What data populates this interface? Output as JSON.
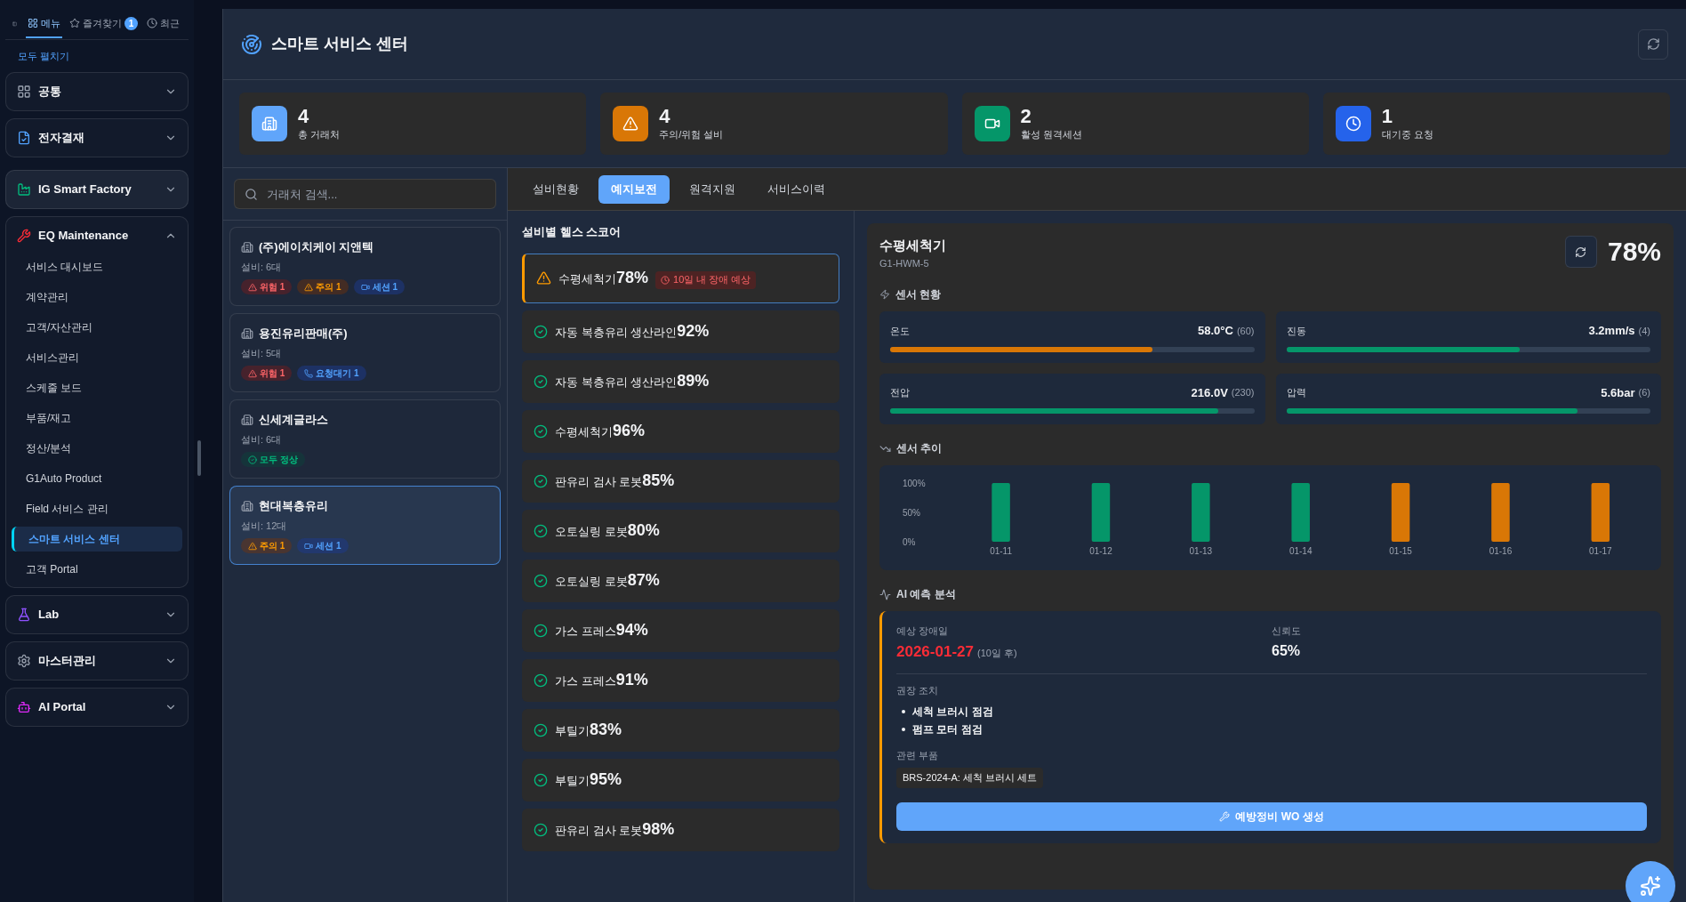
{
  "sidebar": {
    "tabs": [
      {
        "label": "메뉴",
        "selected": true
      },
      {
        "label": "즐겨찾기",
        "badge": "1",
        "selected": false
      },
      {
        "label": "최근",
        "selected": false
      }
    ],
    "expand_all": "모두 펼치기",
    "groups": [
      {
        "label": "공통",
        "expanded": false
      },
      {
        "label": "전자결재",
        "expanded": false
      },
      {
        "label": "IG Smart Factory",
        "expanded": false
      },
      {
        "label": "EQ Maintenance",
        "expanded": true,
        "items": [
          {
            "label": "서비스 대시보드",
            "selected": false
          },
          {
            "label": "계약관리",
            "selected": false
          },
          {
            "label": "고객/자산관리",
            "selected": false
          },
          {
            "label": "서비스관리",
            "selected": false
          },
          {
            "label": "스케줄 보드",
            "selected": false
          },
          {
            "label": "부품/재고",
            "selected": false
          },
          {
            "label": "정산/분석",
            "selected": false
          },
          {
            "label": "G1Auto Product",
            "selected": false
          },
          {
            "label": "Field 서비스 관리",
            "selected": false
          },
          {
            "label": "스마트 서비스 센터",
            "selected": true
          },
          {
            "label": "고객 Portal",
            "selected": false
          }
        ]
      },
      {
        "label": "Lab",
        "expanded": false
      },
      {
        "label": "마스터관리",
        "expanded": false
      },
      {
        "label": "AI Portal",
        "expanded": false
      }
    ]
  },
  "header": {
    "title": "스마트 서비스 센터"
  },
  "stats": [
    {
      "value": "4",
      "label": "총 거래처",
      "color": "#60a5fa"
    },
    {
      "value": "4",
      "label": "주의/위험 설비",
      "color": "#d97706"
    },
    {
      "value": "2",
      "label": "활성 원격세션",
      "color": "#059669"
    },
    {
      "value": "1",
      "label": "대기중 요청",
      "color": "#2563eb"
    }
  ],
  "customers": {
    "search": {
      "placeholder": "거래처 검색..."
    },
    "items": [
      {
        "name": "(주)에이치케이 지앤텍",
        "equipment": "설비: 6대",
        "selected": false,
        "tags": [
          {
            "kind": "danger",
            "label": "위험 1"
          },
          {
            "kind": "warning",
            "label": "주의 1"
          },
          {
            "kind": "session",
            "label": "세션 1"
          }
        ]
      },
      {
        "name": "용진유리판매(주)",
        "equipment": "설비: 5대",
        "selected": false,
        "tags": [
          {
            "kind": "danger",
            "label": "위험 1"
          },
          {
            "kind": "request",
            "label": "요청대기 1"
          }
        ]
      },
      {
        "name": "신세계글라스",
        "equipment": "설비: 6대",
        "selected": false,
        "tags": [
          {
            "kind": "ok",
            "label": "모두 정상"
          }
        ]
      },
      {
        "name": "현대복층유리",
        "equipment": "설비: 12대",
        "selected": true,
        "tags": [
          {
            "kind": "warning",
            "label": "주의 1"
          },
          {
            "kind": "session",
            "label": "세션 1"
          }
        ]
      }
    ]
  },
  "tabs": [
    {
      "label": "설비현황",
      "selected": false
    },
    {
      "label": "예지보전",
      "selected": true
    },
    {
      "label": "원격지원",
      "selected": false
    },
    {
      "label": "서비스이력",
      "selected": false
    }
  ],
  "health": {
    "title": "설비별 헬스 스코어",
    "items": [
      {
        "kind": "warning",
        "name": "수평세척기",
        "score": "78%",
        "alert": "10일 내 장애 예상",
        "selected": true
      },
      {
        "kind": "ok",
        "name": "자동 복층유리 생산라인",
        "score": "92%",
        "selected": false
      },
      {
        "kind": "ok",
        "name": "자동 복층유리 생산라인",
        "score": "89%",
        "selected": false
      },
      {
        "kind": "ok",
        "name": "수평세척기",
        "score": "96%",
        "selected": false
      },
      {
        "kind": "ok",
        "name": "판유리 검사 로봇",
        "score": "85%",
        "selected": false
      },
      {
        "kind": "ok",
        "name": "오토실링 로봇",
        "score": "80%",
        "selected": false
      },
      {
        "kind": "ok",
        "name": "오토실링 로봇",
        "score": "87%",
        "selected": false
      },
      {
        "kind": "ok",
        "name": "가스 프레스",
        "score": "94%",
        "selected": false
      },
      {
        "kind": "ok",
        "name": "가스 프레스",
        "score": "91%",
        "selected": false
      },
      {
        "kind": "ok",
        "name": "부틸기",
        "score": "83%",
        "selected": false
      },
      {
        "kind": "ok",
        "name": "부틸기",
        "score": "95%",
        "selected": false
      },
      {
        "kind": "ok",
        "name": "판유리 검사 로봇",
        "score": "98%",
        "selected": false
      }
    ]
  },
  "detail": {
    "name": "수평세척기",
    "code": "G1-HWM-5",
    "score": "78%",
    "sensors_title": "센서 현황",
    "sensors": [
      {
        "label": "온도",
        "value": "58.0°C",
        "limit": "(60)",
        "level": 0.72,
        "color": "#d97706"
      },
      {
        "label": "진동",
        "value": "3.2mm/s",
        "limit": "(4)",
        "level": 0.64,
        "color": "#059669"
      },
      {
        "label": "전압",
        "value": "216.0V",
        "limit": "(230)",
        "level": 0.9,
        "color": "#059669"
      },
      {
        "label": "압력",
        "value": "5.6bar",
        "limit": "(6)",
        "level": 0.8,
        "color": "#059669"
      }
    ],
    "trend_title": "센서 추이",
    "chart_data": {
      "type": "bar",
      "categories": [
        "01-11",
        "01-12",
        "01-13",
        "01-14",
        "01-15",
        "01-16",
        "01-17"
      ],
      "stacked": true,
      "ylim": [
        0,
        100
      ],
      "yticks": [
        {
          "value": 0,
          "label": "0%"
        },
        {
          "value": 50,
          "label": "50%"
        },
        {
          "value": 100,
          "label": "100%"
        }
      ],
      "series": [
        {
          "color": "#059669",
          "values": [
            100,
            100,
            100,
            100,
            null,
            null,
            null
          ]
        },
        {
          "color": "#d97706",
          "values": [
            null,
            null,
            null,
            null,
            100,
            100,
            100
          ]
        }
      ]
    },
    "ai": {
      "title": "AI 예측 분석",
      "failure_label": "예상 장애일",
      "failure_date": "2026-01-27",
      "failure_after": "(10일 후)",
      "confidence_label": "신뢰도",
      "confidence": "65%",
      "actions_label": "권장 조치",
      "actions": [
        "세척 브러시 점검",
        "펌프 모터 점검"
      ],
      "parts_label": "관련 부품",
      "parts": [
        "BRS-2024-A: 세척 브러시 세트"
      ],
      "button": "예방정비 WO 생성"
    }
  }
}
